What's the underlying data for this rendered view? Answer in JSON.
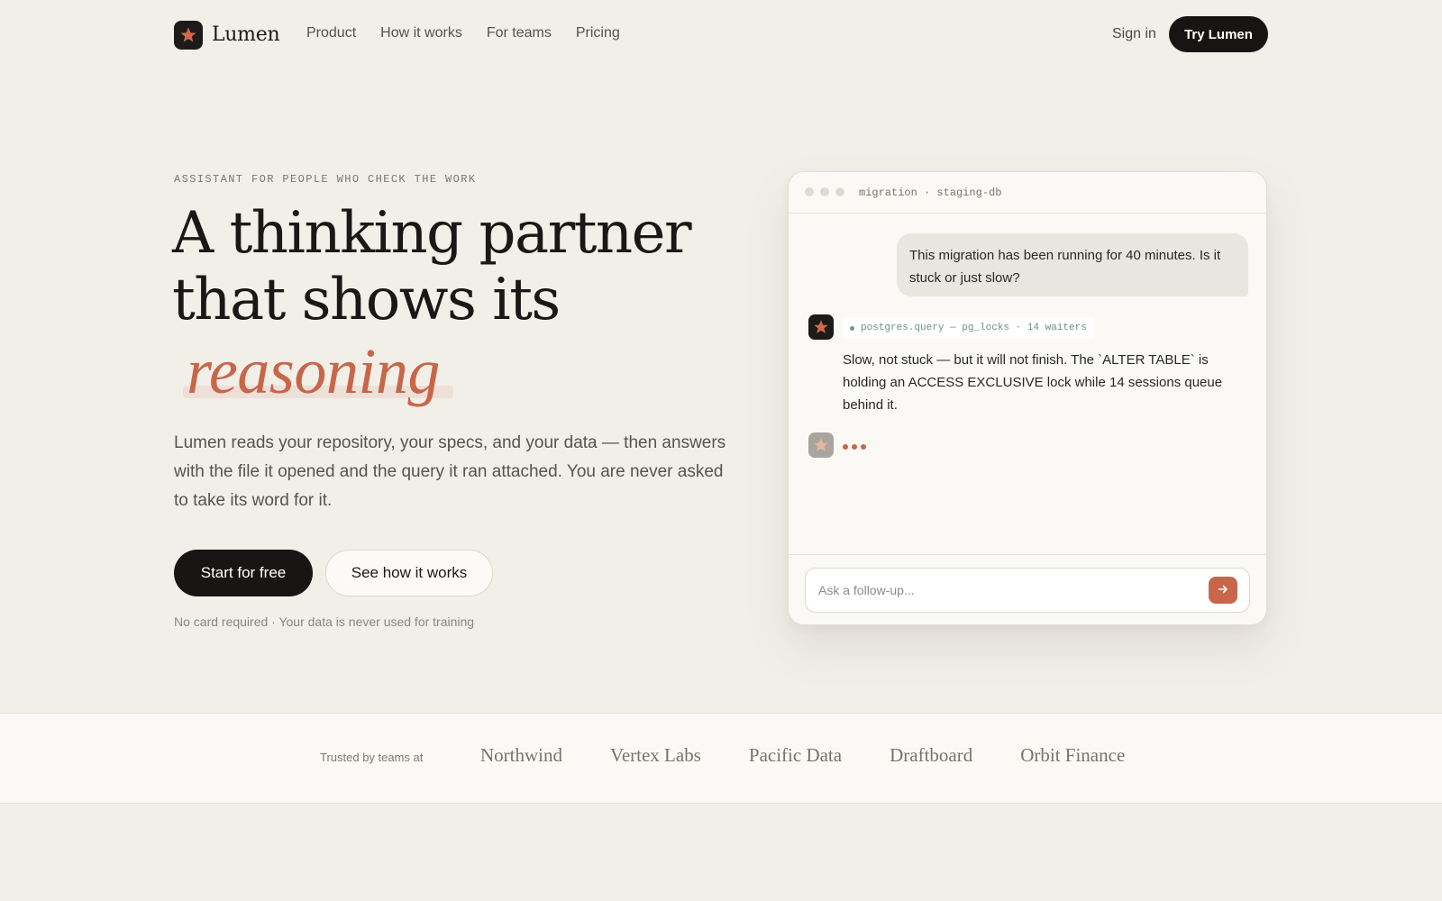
{
  "nav": {
    "brand": "Lumen",
    "links": [
      "Product",
      "How it works",
      "For teams",
      "Pricing"
    ],
    "sign_in": "Sign in",
    "cta": "Try Lumen"
  },
  "hero": {
    "eyebrow": "ASSISTANT FOR PEOPLE WHO CHECK THE WORK",
    "headline_line1": "A thinking partner",
    "headline_line2": "that shows its",
    "headline_accent": "reasoning",
    "lede": "Lumen reads your repository, your specs, and your data — then answers with the file it opened and the query it ran attached. You are never asked to take its word for it.",
    "primary_cta": "Start for free",
    "secondary_cta": "See how it works",
    "fineprint": "No card required · Your data is never used for training"
  },
  "chat": {
    "title": "migration · staging-db",
    "user_message": "This migration has been running for 40 minutes. Is it stuck or just slow?",
    "tool_call": "postgres.query — pg_locks · 14 waiters",
    "assistant_reply": "Slow, not stuck — but it will not finish. The `ALTER TABLE` is holding an ACCESS EXCLUSIVE lock while 14 sessions queue behind it.",
    "input_placeholder": "Ask a follow-up...",
    "send_icon": "arrow-right-icon"
  },
  "trust": {
    "label": "Trusted by teams at",
    "companies": [
      "Northwind",
      "Vertex Labs",
      "Pacific Data",
      "Draftboard",
      "Orbit Finance"
    ]
  },
  "colors": {
    "background": "#f2efe9",
    "accent": "#c8664a",
    "dark": "#171614",
    "tool_green": "#6e8f85"
  }
}
